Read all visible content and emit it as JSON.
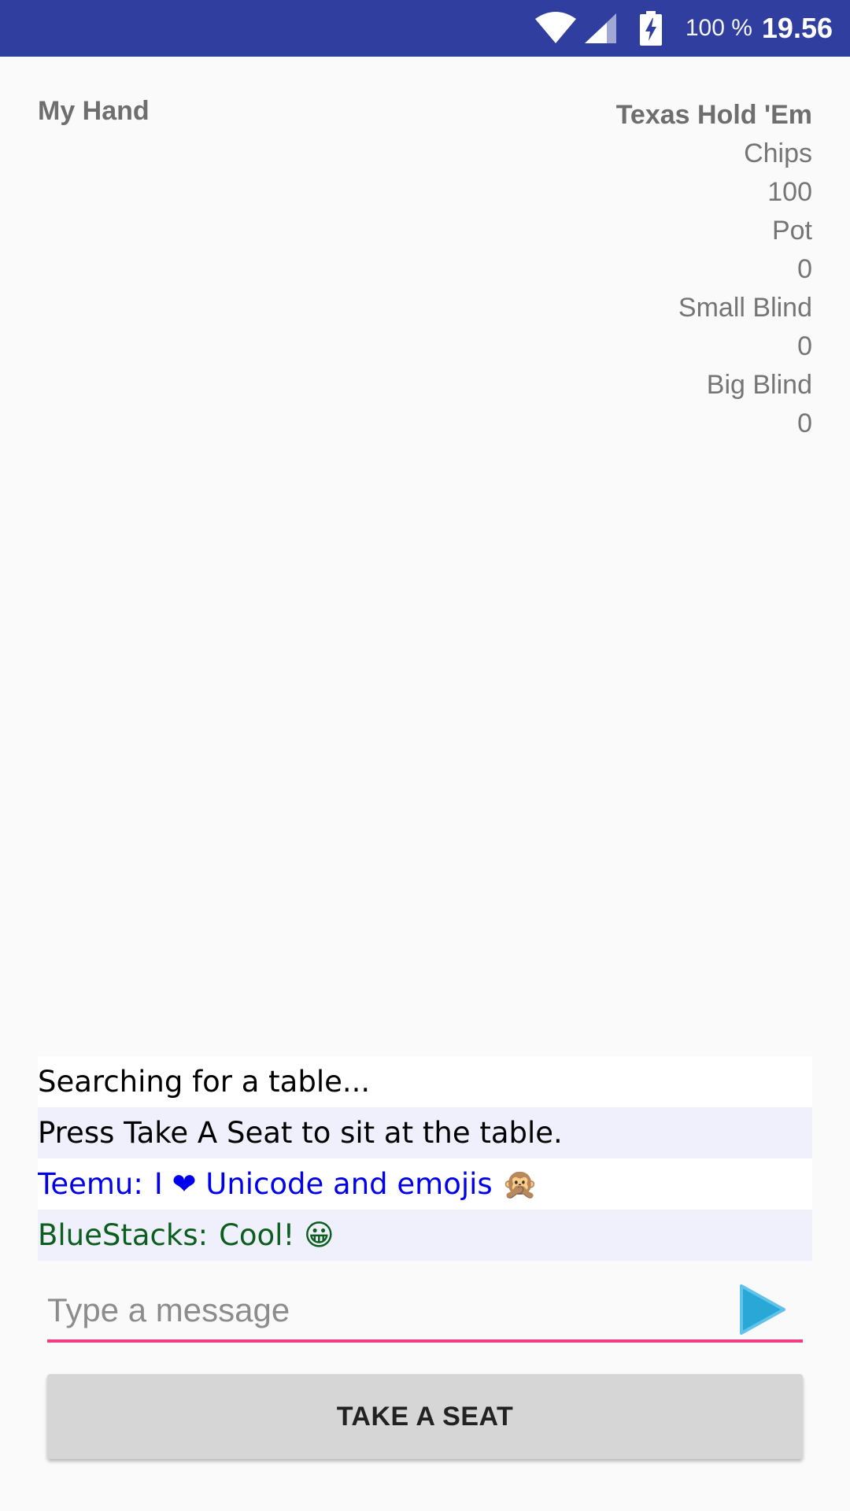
{
  "status_bar": {
    "battery_percent": "100 %",
    "time": "19.56",
    "background_color": "#303f9f",
    "icons": [
      "wifi-icon",
      "signal-icon",
      "battery-charging-icon"
    ]
  },
  "hand": {
    "label": "My Hand"
  },
  "game_info": {
    "title": "Texas Hold 'Em",
    "chips_label": "Chips",
    "chips_value": "100",
    "pot_label": "Pot",
    "pot_value": "0",
    "small_blind_label": "Small Blind",
    "small_blind_value": "0",
    "big_blind_label": "Big Blind",
    "big_blind_value": "0"
  },
  "chat": {
    "messages": [
      {
        "sender": "",
        "text": "Searching for a table...",
        "color": "#000000"
      },
      {
        "sender": "",
        "text": "Press Take A Seat to sit at the table.",
        "color": "#000000"
      },
      {
        "sender": "Teemu:",
        "text": "I ❤ Unicode and emojis 🙊",
        "color": "#0000ee"
      },
      {
        "sender": "BlueStacks:",
        "text": "Cool! 😀",
        "color": "#0b5e1e"
      }
    ]
  },
  "composer": {
    "placeholder": "Type a message",
    "accent_color": "#ee4080",
    "send_icon": "send-play-icon",
    "send_icon_color": "#29a8d8"
  },
  "actions": {
    "take_seat_label": "TAKE A SEAT"
  }
}
